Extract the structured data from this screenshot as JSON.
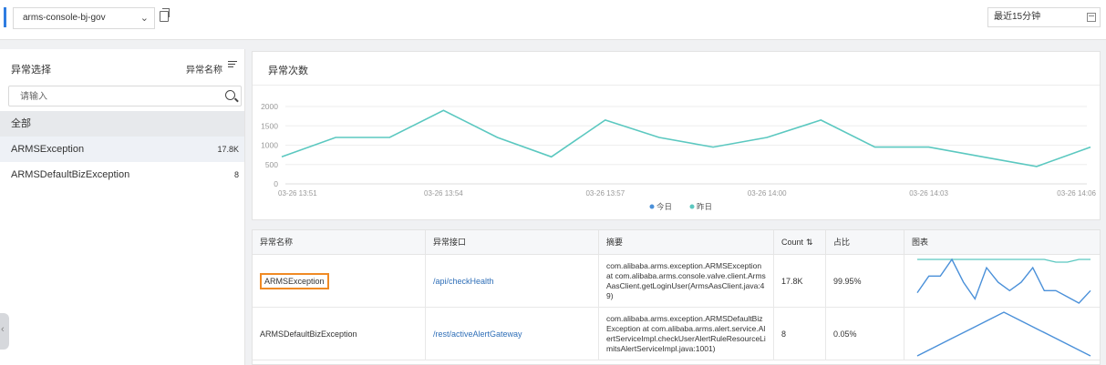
{
  "topbar": {
    "app_name": "arms-console-bj-gov",
    "time_range": "最近15分钟"
  },
  "left_panel": {
    "title": "异常选择",
    "sort_label": "异常名称",
    "search_placeholder": "请输入",
    "all_label": "全部",
    "items": [
      {
        "name": "ARMSException",
        "count": "17.8K"
      },
      {
        "name": "ARMSDefaultBizException",
        "count": "8"
      }
    ]
  },
  "chart_panel": {
    "title": "异常次数"
  },
  "chart_data": {
    "type": "line",
    "x_ticks": [
      "03-26 13:51",
      "03-26 13:54",
      "03-26 13:57",
      "03-26 14:00",
      "03-26 14:03",
      "03-26 14:06"
    ],
    "ylim": [
      0,
      2000
    ],
    "y_ticks": [
      0,
      500,
      1000,
      1500,
      2000
    ],
    "legend": [
      "今日",
      "昨日"
    ],
    "legend_colors": [
      "#4a90d9",
      "#5bc8c0"
    ],
    "series": [
      {
        "name": "昨日",
        "x": [
          "03-26 13:51",
          "03-26 13:52",
          "03-26 13:53",
          "03-26 13:54",
          "03-26 13:55",
          "03-26 13:56",
          "03-26 13:57",
          "03-26 13:58",
          "03-26 13:59",
          "03-26 14:00",
          "03-26 14:01",
          "03-26 14:02",
          "03-26 14:03",
          "03-26 14:04",
          "03-26 14:05",
          "03-26 14:06"
        ],
        "values": [
          700,
          1200,
          1200,
          1900,
          1200,
          700,
          1650,
          1200,
          950,
          1200,
          1650,
          950,
          950,
          700,
          450,
          950
        ]
      }
    ],
    "grid": true,
    "legend_position": "bottom"
  },
  "table": {
    "headers": [
      "异常名称",
      "异常接口",
      "摘要",
      "Count",
      "占比",
      "图表"
    ],
    "rows": [
      {
        "name": "ARMSException",
        "api": "/api/checkHealth",
        "summary": "com.alibaba.arms.exception.ARMSException at com.alibaba.arms.console.valve.client.ArmsAasClient.getLoginUser(ArmsAasClient.java:49)",
        "count": "17.8K",
        "ratio": "99.95%",
        "spark": [
          12,
          28,
          28,
          44,
          22,
          6,
          36,
          22,
          14,
          22,
          36,
          14,
          14,
          8,
          2,
          14
        ]
      },
      {
        "name": "ARMSDefaultBizException",
        "api": "/rest/activeAlertGateway",
        "summary": "com.alibaba.arms.exception.ARMSDefaultBizException at com.alibaba.arms.alert.service.AlertServiceImpl.checkUserAlertRuleResourceLimitsAlertServiceImpl.java:1001)",
        "count": "8",
        "ratio": "0.05%",
        "spark": [
          0,
          10,
          20,
          30,
          40,
          50,
          40,
          30,
          20,
          10,
          0
        ]
      }
    ]
  },
  "colors": {
    "accent": "#2f7de1",
    "line": "#5bc8c0",
    "spark": "#4a90d9",
    "highlight": "#f08a24"
  }
}
